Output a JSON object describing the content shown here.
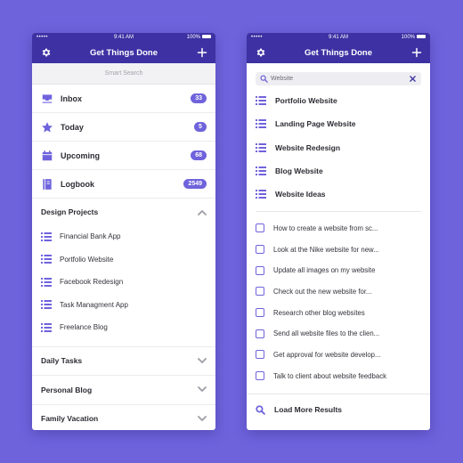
{
  "colors": {
    "background": "#6f63dc",
    "header": "#3d31a3",
    "accent": "#6f63dc",
    "text": "#2b2b33"
  },
  "status_bar": {
    "signal": "•••••",
    "time": "9:41 AM",
    "battery": "100%"
  },
  "left": {
    "header": {
      "title": "Get Things Done",
      "left_icon": "gear-icon",
      "right_icon": "plus-icon"
    },
    "smart_search": {
      "placeholder": "Smart Search"
    },
    "main_items": [
      {
        "label": "Inbox",
        "icon": "inbox-tray-icon",
        "count": "33"
      },
      {
        "label": "Today",
        "icon": "star-icon",
        "count": "5"
      },
      {
        "label": "Upcoming",
        "icon": "calendar-icon",
        "count": "68"
      },
      {
        "label": "Logbook",
        "icon": "logbook-icon",
        "count": "2549"
      }
    ],
    "expanded_section": {
      "title": "Design Projects",
      "chevron": "chevron-up-icon",
      "items": [
        {
          "label": "Financial Bank App"
        },
        {
          "label": "Portfolio Website"
        },
        {
          "label": "Facebook Redesign"
        },
        {
          "label": "Task Managment App"
        },
        {
          "label": "Freelance Blog"
        }
      ]
    },
    "collapsed_sections": [
      {
        "title": "Daily Tasks"
      },
      {
        "title": "Personal Blog"
      },
      {
        "title": "Family Vacation"
      }
    ]
  },
  "right": {
    "header": {
      "title": "Get Things Done",
      "left_icon": "gear-icon",
      "right_icon": "plus-icon"
    },
    "search": {
      "value": "Website"
    },
    "list_results": [
      {
        "label": "Portfolio Website"
      },
      {
        "label": "Landing Page Website"
      },
      {
        "label": "Website Redesign"
      },
      {
        "label": "Blog Website"
      },
      {
        "label": "Website Ideas"
      }
    ],
    "task_results": [
      {
        "label": "How to create a website from sc..."
      },
      {
        "label": "Look at the Nike website for new..."
      },
      {
        "label": "Update all images on my website"
      },
      {
        "label": "Check out the new website for..."
      },
      {
        "label": "Research other blog websites"
      },
      {
        "label": "Send all website files to the clien..."
      },
      {
        "label": "Get approval for website develop..."
      },
      {
        "label": "Talk to client about website feedback"
      }
    ],
    "load_more": {
      "label": "Load More Results"
    }
  }
}
